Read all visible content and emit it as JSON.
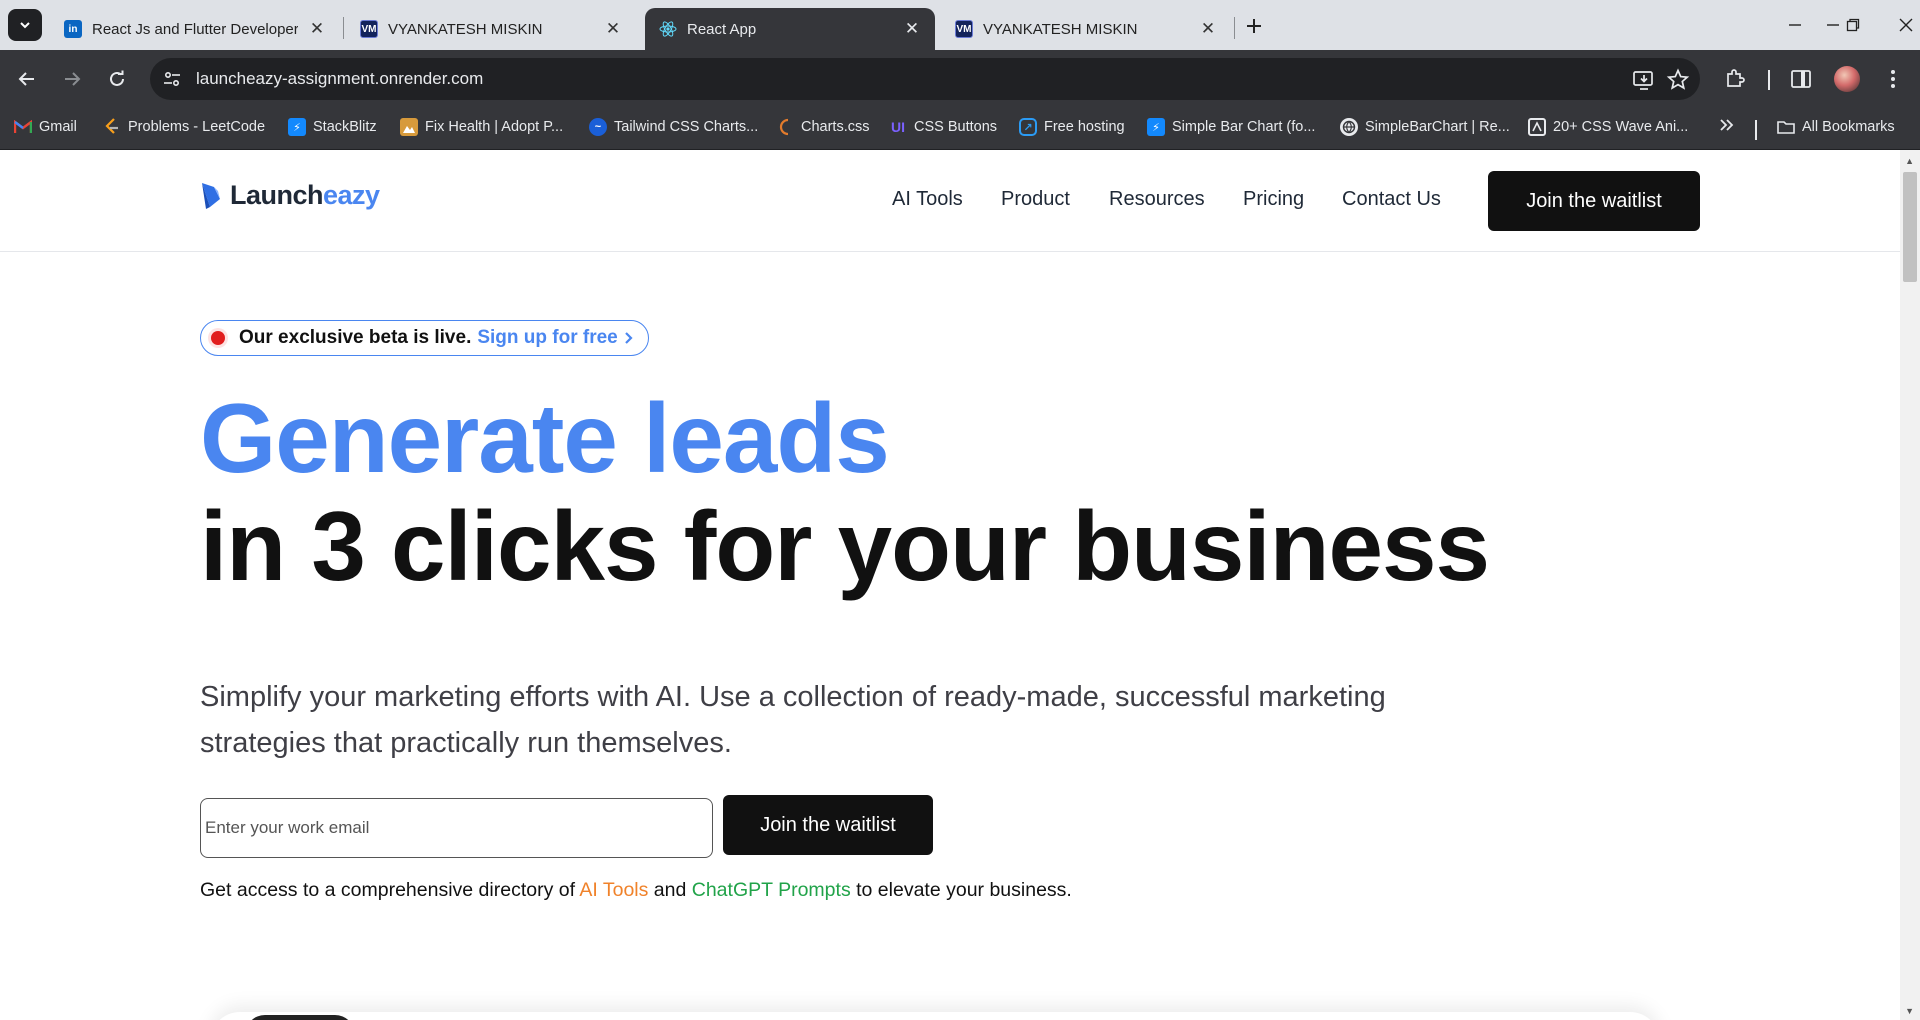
{
  "browser": {
    "tabs": [
      {
        "title": "React Js and Flutter Developer | ",
        "favicon": "linkedin-icon",
        "active": false
      },
      {
        "title": "VYANKATESH MISKIN",
        "favicon": "vm-icon",
        "active": false
      },
      {
        "title": "React App",
        "favicon": "react-icon",
        "active": true
      },
      {
        "title": "VYANKATESH MISKIN",
        "favicon": "vm-icon",
        "active": false
      }
    ],
    "url": "launcheazy-assignment.onrender.com",
    "bookmarks": [
      {
        "label": "Gmail",
        "icon": "gmail-icon"
      },
      {
        "label": "Problems - LeetCode",
        "icon": "leetcode-icon"
      },
      {
        "label": "StackBlitz",
        "icon": "stackblitz-icon"
      },
      {
        "label": "Fix Health | Adopt P...",
        "icon": "fixhealth-icon"
      },
      {
        "label": "Tailwind CSS Charts...",
        "icon": "tailwind-icon"
      },
      {
        "label": "Charts.css",
        "icon": "chartscss-icon"
      },
      {
        "label": "CSS Buttons",
        "icon": "ui-icon"
      },
      {
        "label": "Free hosting",
        "icon": "hosting-icon"
      },
      {
        "label": "Simple Bar Chart (fo...",
        "icon": "stackblitz-icon"
      },
      {
        "label": "SimpleBarChart | Re...",
        "icon": "globe-icon"
      },
      {
        "label": "20+ CSS Wave Ani...",
        "icon": "wave-icon"
      }
    ],
    "all_bookmarks_label": "All Bookmarks"
  },
  "site": {
    "logo": {
      "prefix": "Launch",
      "accent": "eazy"
    },
    "nav": [
      "AI Tools",
      "Product",
      "Resources",
      "Pricing",
      "Contact Us"
    ],
    "header_cta": "Join the waitlist",
    "beta": {
      "text": "Our exclusive beta is live.",
      "link": "Sign up for free"
    },
    "hero": {
      "line1": "Generate leads",
      "line2": "in 3 clicks for your business"
    },
    "lede": "Simplify your marketing efforts with AI. Use a collection of ready-made, successful marketing strategies that practically run themselves.",
    "email_placeholder": "Enter your work email",
    "form_cta": "Join the waitlist",
    "access": {
      "before": "Get access to a comprehensive directory of ",
      "link1": "AI Tools",
      "middle": " and ",
      "link2": "ChatGPT Prompts",
      "after": " to elevate your business."
    }
  },
  "colors": {
    "accent_blue": "#4a86f0",
    "link_orange": "#f0822a",
    "link_green": "#21a349",
    "cta_black": "#111111",
    "beta_dot_red": "#e11d1d"
  }
}
